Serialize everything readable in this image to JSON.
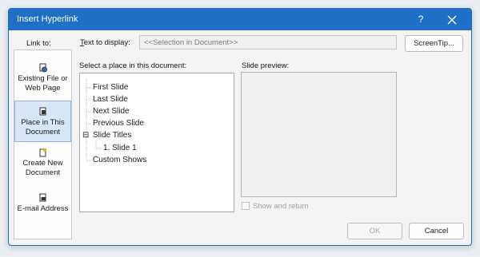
{
  "window": {
    "title": "Insert Hyperlink",
    "help_glyph": "?",
    "close_icon": "close-icon"
  },
  "link_to": {
    "label": "Link to:",
    "items": [
      {
        "line1": "Existing File or",
        "line2": "Web Page",
        "icon": "globe-file-icon",
        "active": false
      },
      {
        "line1": "Place in This",
        "line2": "Document",
        "icon": "document-place-icon",
        "active": true
      },
      {
        "line1": "Create New",
        "line2": "Document",
        "icon": "new-document-icon",
        "active": false
      },
      {
        "line1": "E-mail Address",
        "line2": "",
        "icon": "email-icon",
        "active": false
      }
    ]
  },
  "text_to_display": {
    "label_prefix": "T",
    "label_rest": "ext to display:",
    "value": "<<Selection in Document>>"
  },
  "buttons": {
    "screentip": "ScreenTip...",
    "ok": "OK",
    "cancel": "Cancel"
  },
  "place_list": {
    "label": "Select a place in this document:",
    "items": [
      {
        "label": "First Slide"
      },
      {
        "label": "Last Slide"
      },
      {
        "label": "Next Slide"
      },
      {
        "label": "Previous Slide"
      },
      {
        "label": "Slide Titles",
        "expander": "⊟"
      },
      {
        "label": "1. Slide 1"
      },
      {
        "label": "Custom Shows"
      }
    ]
  },
  "preview": {
    "label": "Slide preview:"
  },
  "show_and_return": {
    "label": "Show and return",
    "checked": false
  },
  "colors": {
    "titlebar": "#1f6fc6",
    "active_item": "#d7e7f7"
  }
}
